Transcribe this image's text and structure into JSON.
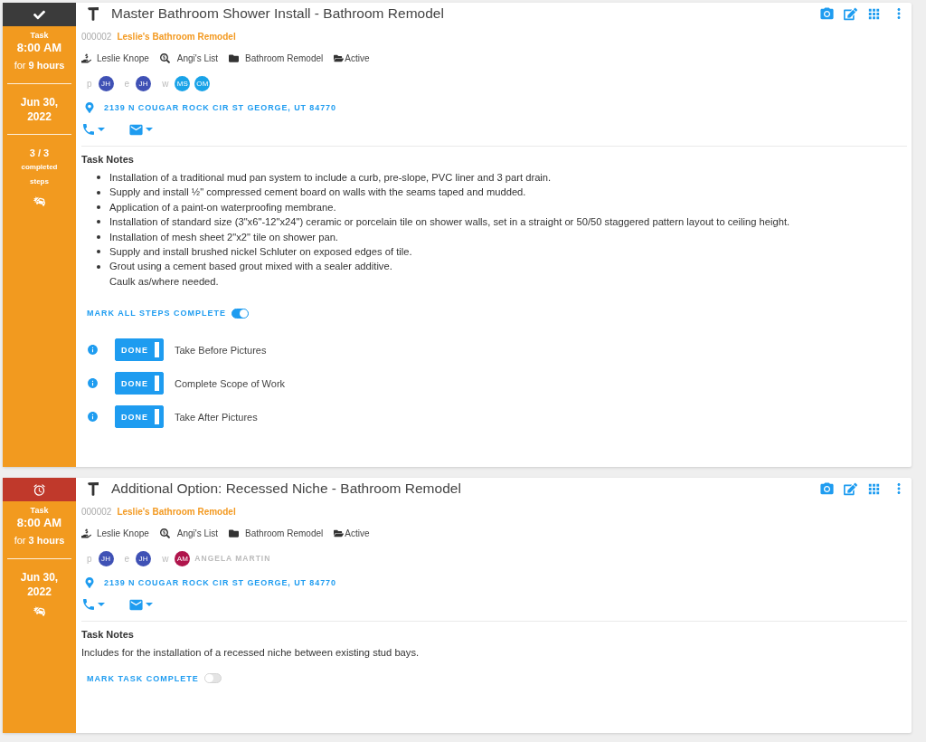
{
  "tasks": [
    {
      "completed": true,
      "overdue": false,
      "type_label": "Task",
      "time": "8:00 AM",
      "duration": "for **9 hours**",
      "date": "Jun 30, 2022",
      "steps_count": "3 / 3",
      "steps_label": "completed steps",
      "title": "Master Bathroom Shower Install - Bathroom Remodel",
      "number": "000002",
      "project": "Leslie's Bathroom Remodel",
      "meta": [
        {
          "kind": "customer",
          "text": "Leslie Knope"
        },
        {
          "kind": "source",
          "text": "Angi's List"
        },
        {
          "kind": "category",
          "text": "Bathroom Remodel"
        },
        {
          "kind": "status",
          "text": "Active"
        }
      ],
      "team": [
        {
          "role": "p",
          "members": [
            {
              "initials": "JH",
              "color": "#3f51b5"
            }
          ]
        },
        {
          "role": "e",
          "members": [
            {
              "initials": "JH",
              "color": "#3f51b5"
            }
          ]
        },
        {
          "role": "w",
          "members": [
            {
              "initials": "MS",
              "color": "#1aa3e8"
            },
            {
              "initials": "OM",
              "color": "#1aa3e8"
            }
          ]
        }
      ],
      "address": "2139 N COUGAR ROCK CIR ST GEORGE, UT 84770",
      "notes_title": "Task Notes",
      "notes": [
        {
          "kind": "bullet",
          "text": "Installation of a traditional mud pan system to include a curb, pre-slope, PVC liner and 3 part drain."
        },
        {
          "kind": "bullet",
          "text": "Supply and install ½\" compressed cement board on walls with the seams taped and mudded."
        },
        {
          "kind": "bullet",
          "text": "Application of a paint-on waterproofing membrane."
        },
        {
          "kind": "bullet",
          "text": "Installation of standard size (3\"x6\"-12\"x24\") ceramic or porcelain tile on shower walls, set in a straight or 50/50 staggered pattern layout to ceiling height."
        },
        {
          "kind": "bullet",
          "text": "Installation of mesh sheet 2\"x2\" tile on shower pan."
        },
        {
          "kind": "bullet",
          "text": "Supply and install brushed nickel Schluter on exposed edges of tile."
        },
        {
          "kind": "bullet",
          "text": "Grout using a cement based grout mixed with a sealer additive."
        },
        {
          "kind": "line",
          "text": "Caulk as/where needed."
        }
      ],
      "complete_toggle": {
        "label": "MARK ALL STEPS COMPLETE",
        "on": true
      },
      "steps": [
        {
          "button": "DONE",
          "label": "Take Before Pictures",
          "done": true
        },
        {
          "button": "DONE",
          "label": "Complete Scope of Work",
          "done": true
        },
        {
          "button": "DONE",
          "label": "Take After Pictures",
          "done": true
        }
      ]
    },
    {
      "completed": false,
      "overdue": true,
      "type_label": "Task",
      "time": "8:00 AM",
      "duration": "for **3 hours**",
      "date": "Jun 30, 2022",
      "title": "Additional Option: Recessed Niche - Bathroom Remodel",
      "number": "000002",
      "project": "Leslie's Bathroom Remodel",
      "meta": [
        {
          "kind": "customer",
          "text": "Leslie Knope"
        },
        {
          "kind": "source",
          "text": "Angi's List"
        },
        {
          "kind": "category",
          "text": "Bathroom Remodel"
        },
        {
          "kind": "status",
          "text": "Active"
        }
      ],
      "team": [
        {
          "role": "p",
          "members": [
            {
              "initials": "JH",
              "color": "#3f51b5"
            }
          ]
        },
        {
          "role": "e",
          "members": [
            {
              "initials": "JH",
              "color": "#3f51b5"
            }
          ]
        },
        {
          "role": "w",
          "members": [
            {
              "initials": "AM",
              "color": "#b0154c",
              "name": "ANGELA MARTIN"
            }
          ]
        }
      ],
      "address": "2139 N COUGAR ROCK CIR ST GEORGE, UT 84770",
      "notes_title": "Task Notes",
      "notes": [
        {
          "kind": "paragraph",
          "text": "Includes for the installation of a recessed niche between existing stud bays."
        }
      ],
      "complete_toggle": {
        "label": "MARK TASK COMPLETE",
        "on": false
      }
    }
  ]
}
